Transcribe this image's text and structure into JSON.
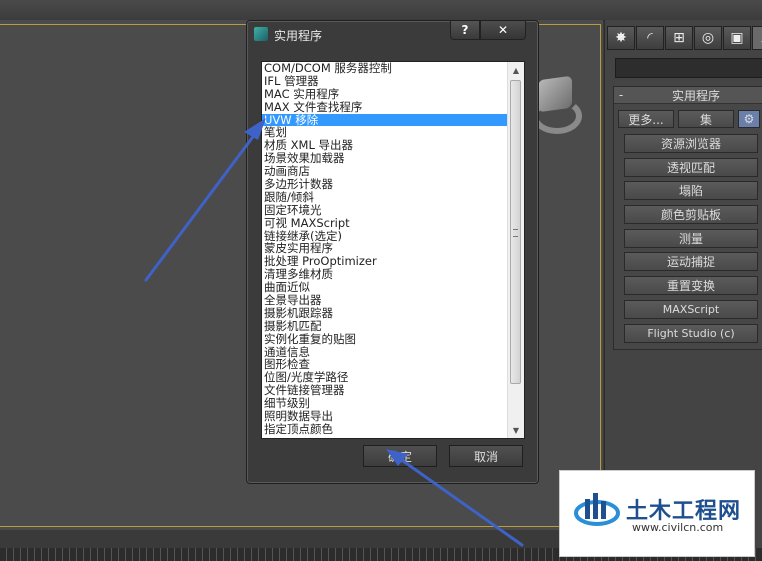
{
  "dialog": {
    "title": "实用程序",
    "help_glyph": "?",
    "close_glyph": "✕",
    "items": [
      "COM/DCOM 服务器控制",
      "IFL 管理器",
      "MAC 实用程序",
      "MAX 文件查找程序",
      "UVW 移除",
      "笔划",
      "材质 XML 导出器",
      "场景效果加载器",
      "动画商店",
      "多边形计数器",
      "跟随/倾斜",
      "固定环境光",
      "可视 MAXScript",
      "链接继承(选定)",
      "蒙皮实用程序",
      "批处理 ProOptimizer",
      "清理多维材质",
      "曲面近似",
      "全景导出器",
      "摄影机跟踪器",
      "摄影机匹配",
      "实例化重复的贴图",
      "通道信息",
      "图形检查",
      "位图/光度学路径",
      "文件链接管理器",
      "细节级别",
      "照明数据导出",
      "指定顶点颜色"
    ],
    "selected_index": 4,
    "ok_label": "确定",
    "cancel_label": "取消"
  },
  "panel": {
    "tab_icons": [
      "sun-icon",
      "arc-icon",
      "hierarchy-icon",
      "motion-icon",
      "display-icon",
      "utilities-icon"
    ],
    "tab_glyphs": [
      "✸",
      "◜",
      "⊞",
      "◎",
      "▣",
      "⟋"
    ],
    "rollout_collapse": "-",
    "rollout_title": "实用程序",
    "more_label": "更多...",
    "sets_label": "集",
    "config_glyph": "⚙",
    "buttons": [
      "资源浏览器",
      "透视匹配",
      "塌陷",
      "颜色剪贴板",
      "测量",
      "运动捕捉",
      "重置变换",
      "MAXScript",
      "Flight Studio (c)"
    ]
  },
  "watermark": {
    "cn_text": "土木工程网",
    "url": "www.civilcn.com"
  },
  "colors": {
    "selection": "#3399ff",
    "arrow": "#3f62c8",
    "viewport_border": "#b89d3a"
  }
}
